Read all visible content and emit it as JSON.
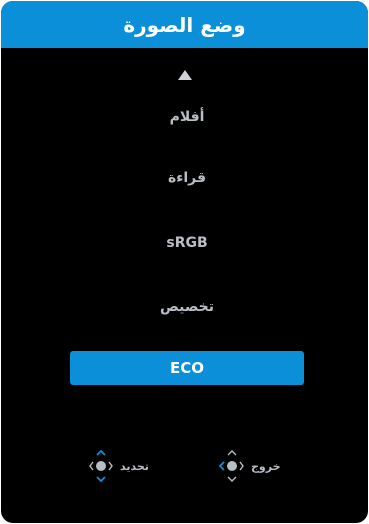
{
  "header": {
    "title": "وضع الصورة"
  },
  "menu": {
    "items": [
      {
        "label": "أفلام",
        "selected": false
      },
      {
        "label": "قراءة",
        "selected": false
      },
      {
        "label": "sRGB",
        "selected": false
      },
      {
        "label": "تخصيص",
        "selected": false
      },
      {
        "label": "ECO",
        "selected": true
      }
    ]
  },
  "footer": {
    "select_hint": "تحديد",
    "exit_hint": "خروج"
  },
  "icons": {
    "scroll_up": "triangle-up-icon",
    "select": "joystick-updown-icon",
    "exit": "joystick-left-icon"
  },
  "colors": {
    "accent": "#0a8fd8",
    "background": "#000000",
    "text": "#b8bec4",
    "title_text": "#ffffff"
  }
}
